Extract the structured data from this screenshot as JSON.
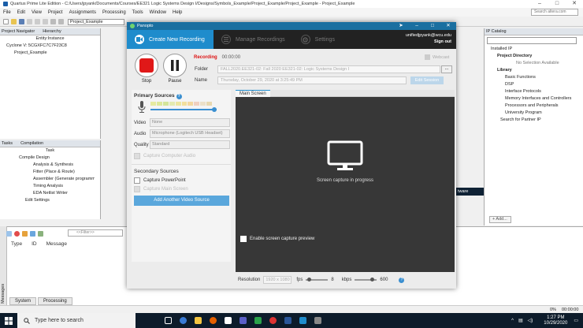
{
  "quartus": {
    "title": "Quartus Prime Lite Edition - C:/Users/jpyank/Documents/Courses/EE321 Logic Systems Design I/Designs/Symbols_Example/Project_Example/Project_Example - Project_Example",
    "menu": [
      "File",
      "Edit",
      "View",
      "Project",
      "Assignments",
      "Processing",
      "Tools",
      "Window",
      "Help"
    ],
    "search_placeholder": "Search altera.com",
    "project_select": "Project_Example",
    "nav_tabs": [
      "Project Navigator",
      "Hierarchy"
    ],
    "nav_col": "Entity:Instance",
    "nav_device": "Cyclone V: 5CGXFC7C7F23C8",
    "nav_project": "Project_Example",
    "tasks_tabs": [
      "Tasks",
      "Compilation"
    ],
    "tasks_col": "Task",
    "tasks": [
      "Compile Design",
      "Analysis & Synthesis",
      "Fitter (Place & Route)",
      "Assembler (Generate programming files)",
      "Timing Analysis",
      "EDA Netlist Writer",
      "Edit Settings"
    ],
    "msg_filter": "<<Filter>>",
    "msg_cols": [
      "Type",
      "ID",
      "Message"
    ],
    "msg_tabs": [
      "System",
      "Processing"
    ],
    "msg_side_label": "Messages",
    "ip_title": "IP Catalog",
    "ip_tree": [
      "Installed IP",
      "Project Directory",
      "No Selection Available",
      "Library",
      "Basic Functions",
      "DSP",
      "Interface Protocols",
      "Memory Interfaces and Controllers",
      "Processors and Peripherals",
      "University Program",
      "Search for Partner IP"
    ],
    "ip_add": "+ Add...",
    "ip_partial": "tware",
    "progress": "0%",
    "elapsed": "00:00:00"
  },
  "panopto": {
    "title": "Panopto",
    "nav": [
      "Create New Recording",
      "Manage Recordings",
      "Settings"
    ],
    "user": "unifiedjpyank@wcu.edu",
    "signout": "Sign out",
    "record_label": "Stop",
    "pause_label": "Pause",
    "recording_text": "Recording",
    "recording_time": "00:00:00",
    "webcast": "Webcast",
    "folder_label": "Folder",
    "folder_value": "FALL2020.EE321-02: Fall 2020 EE321-02: Logic Systems Design I",
    "folder_btn": "...",
    "name_label": "Name",
    "name_value": "Thursday, October 29, 2020 at 3:25:49 PM",
    "settings_btn": "Edit Session",
    "primary_sources": "Primary Sources",
    "help": "?",
    "video_label": "Video",
    "video_value": "None",
    "audio_label": "Audio",
    "audio_value": "Microphone (Logitech USB Headset)",
    "quality_label": "Quality",
    "quality_value": "Standard",
    "capture_computer_audio": "Capture Computer Audio",
    "secondary_sources": "Secondary Sources",
    "capture_powerpoint": "Capture PowerPoint",
    "capture_main_screen": "Capture Main Screen",
    "add_video_source": "Add Another Video Source",
    "screen_tab": "Main Screen",
    "preview_text": "Screen capture in progress",
    "enable_preview": "Enable screen capture preview",
    "resolution_label": "Resolution",
    "resolution_value": "1920 x 1080",
    "fps_label": "fps",
    "fps_value": "8",
    "kbps_label": "kbps",
    "kbps_value": "600"
  },
  "taskbar": {
    "search_placeholder": "Type here to search",
    "time": "1:27 PM",
    "date": "10/29/2020"
  },
  "colors": {
    "panopto_blue": "#1f8ccc",
    "record_red": "#e01818",
    "taskbar": "#0d1c2b"
  }
}
